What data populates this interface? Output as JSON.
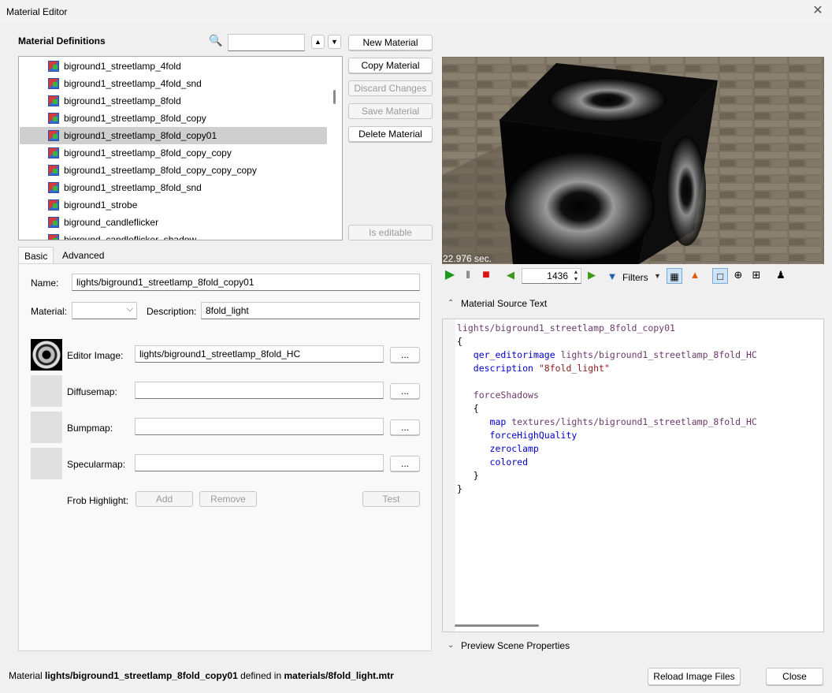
{
  "window": {
    "title": "Material Editor",
    "close_icon": "close-icon"
  },
  "definitions": {
    "title": "Material Definitions",
    "search_value": "",
    "items": [
      "biground1_streetlamp_4fold",
      "biground1_streetlamp_4fold_snd",
      "biground1_streetlamp_8fold",
      "biground1_streetlamp_8fold_copy",
      "biground1_streetlamp_8fold_copy01",
      "biground1_streetlamp_8fold_copy_copy",
      "biground1_streetlamp_8fold_copy_copy_copy",
      "biground1_streetlamp_8fold_snd",
      "biground1_strobe",
      "biground_candleflicker",
      "biground_candleflicker_shadow"
    ],
    "selected_index": 4
  },
  "actions": {
    "new": "New Material",
    "copy": "Copy Material",
    "discard": "Discard Changes",
    "save": "Save Material",
    "delete": "Delete Material",
    "is_editable": "Is editable"
  },
  "tabs": {
    "basic": "Basic",
    "advanced": "Advanced"
  },
  "basic": {
    "name_label": "Name:",
    "name_value": "lights/biground1_streetlamp_8fold_copy01",
    "material_label": "Material:",
    "material_value": "",
    "description_label": "Description:",
    "description_value": "8fold_light",
    "editor_image_label": "Editor Image:",
    "editor_image_value": "lights/biground1_streetlamp_8fold_HC",
    "diffusemap_label": "Diffusemap:",
    "diffusemap_value": "",
    "bumpmap_label": "Bumpmap:",
    "bumpmap_value": "",
    "specularmap_label": "Specularmap:",
    "specularmap_value": "",
    "browse": "...",
    "frob_label": "Frob Highlight:",
    "frob_add": "Add",
    "frob_remove": "Remove",
    "frob_test": "Test"
  },
  "preview": {
    "time": "22.976 sec.",
    "frame": "1436",
    "filters": "Filters"
  },
  "source": {
    "title": "Material Source Text",
    "lines": {
      "l1": "lights/biground1_streetlamp_8fold_copy01",
      "l2": "{",
      "l3_kw": "qer_editorimage",
      "l3_val": " lights/biground1_streetlamp_8fold_HC",
      "l4_kw": "description",
      "l4_val": " \"8fold_light\"",
      "l6": "forceShadows",
      "l7": "{",
      "l8_kw": "map",
      "l8_val": " textures/lights/biground1_streetlamp_8fold_HC",
      "l9": "forceHighQuality",
      "l10": "zeroclamp",
      "l11": "colored",
      "l12": "}",
      "l13": "}"
    }
  },
  "scene_props": {
    "title": "Preview Scene Properties"
  },
  "status": {
    "prefix": "Material ",
    "name": "lights/biground1_streetlamp_8fold_copy01",
    "middle": " defined in ",
    "file": "materials/8fold_light.mtr"
  },
  "footer": {
    "reload": "Reload Image Files",
    "close": "Close"
  }
}
